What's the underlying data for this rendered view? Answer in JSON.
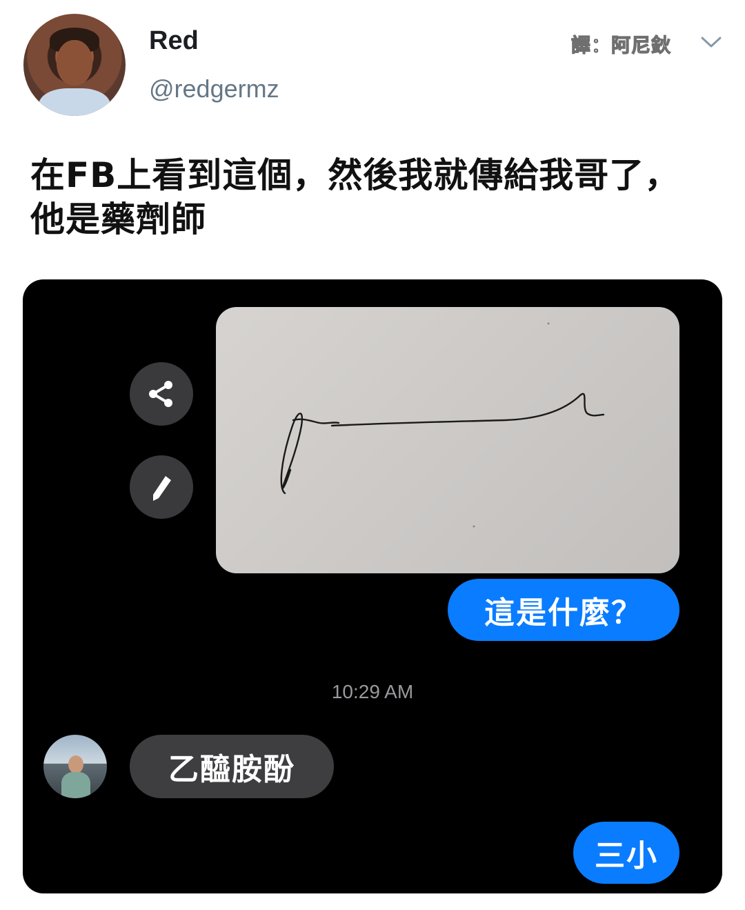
{
  "tweet": {
    "author_name": "Red",
    "author_handle": "@redgermz",
    "translator_credit": "譯：阿尼鈥",
    "text_lines": [
      "在FB上看到這個，然後我就傳給我哥了，",
      "他是藥劑師"
    ]
  },
  "chat": {
    "sent_message": "這是什麼？",
    "timestamp": "10:29 AM",
    "reply_message": "乙醯胺酚",
    "final_message": "三小"
  },
  "icons": {
    "share": "share-icon",
    "edit": "pencil-icon",
    "menu": "chevron-down-icon"
  },
  "colors": {
    "sent_bubble": "#0a7cff",
    "received_bubble": "#3e3e40",
    "chat_background": "#000000"
  }
}
